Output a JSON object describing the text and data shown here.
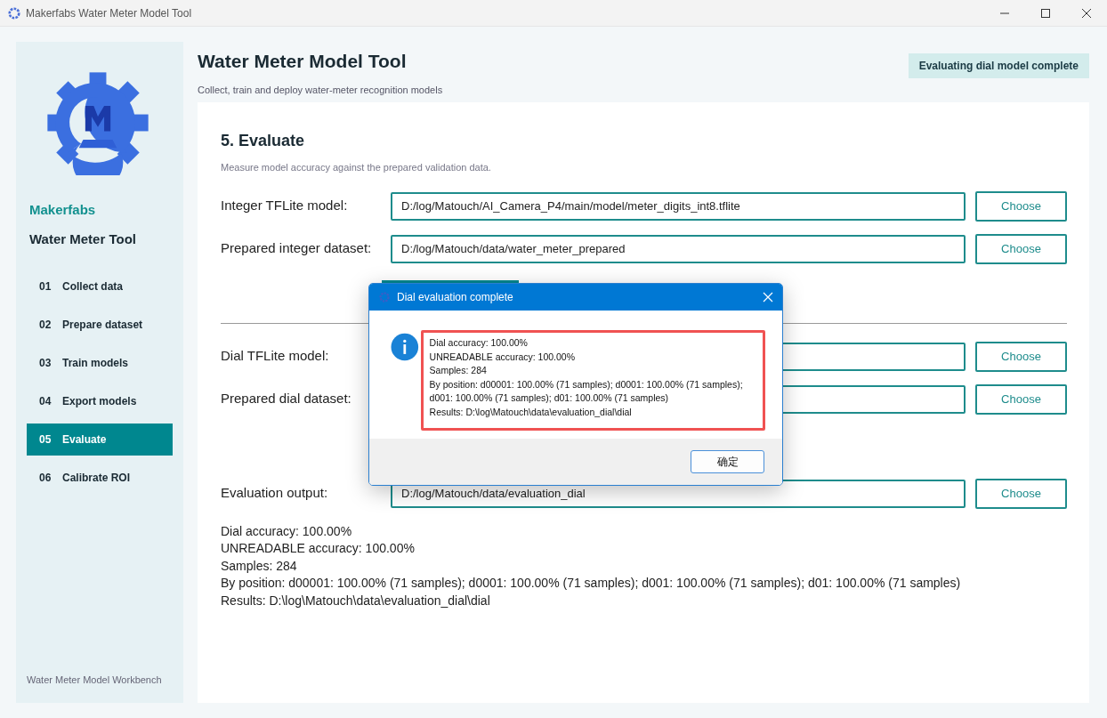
{
  "window": {
    "title": "Makerfabs Water Meter Model Tool"
  },
  "sidebar": {
    "brand": "Makerfabs",
    "product": "Water Meter Tool",
    "footer": "Water Meter Model Workbench",
    "items": [
      {
        "number": "01",
        "label": "Collect data",
        "selected": false
      },
      {
        "number": "02",
        "label": "Prepare dataset",
        "selected": false
      },
      {
        "number": "03",
        "label": "Train models",
        "selected": false
      },
      {
        "number": "04",
        "label": "Export models",
        "selected": false
      },
      {
        "number": "05",
        "label": "Evaluate",
        "selected": true
      },
      {
        "number": "06",
        "label": "Calibrate ROI",
        "selected": false
      }
    ]
  },
  "header": {
    "title": "Water Meter Model Tool",
    "subtitle": "Collect, train and deploy water-meter recognition models",
    "status": "Evaluating dial model complete"
  },
  "section": {
    "title": "5. Evaluate",
    "subtitle": "Measure model accuracy against the prepared validation data.",
    "integer_fields": [
      {
        "label": "Integer TFLite model:",
        "value": "D:/log/Matouch/AI_Camera_P4/main/model/meter_digits_int8.tflite",
        "button": "Choose"
      },
      {
        "label": "Prepared integer dataset:",
        "value": "D:/log/Matouch/data/water_meter_prepared",
        "button": "Choose"
      }
    ],
    "dial_fields": [
      {
        "label": "Dial TFLite model:",
        "button": "Choose"
      },
      {
        "label": "Prepared dial dataset:",
        "button": "Choose"
      }
    ],
    "output_field": {
      "label": "Evaluation output:",
      "value": "D:/log/Matouch/data/evaluation_dial",
      "button": "Choose"
    },
    "results": [
      "Dial accuracy: 100.00%",
      "UNREADABLE accuracy: 100.00%",
      "Samples: 284",
      "By position: d00001: 100.00% (71 samples); d0001: 100.00% (71 samples); d001: 100.00% (71 samples); d01: 100.00% (71 samples)",
      "Results: D:\\log\\Matouch\\data\\evaluation_dial\\dial"
    ]
  },
  "dialog": {
    "title": "Dial evaluation complete",
    "lines": [
      "Dial accuracy: 100.00%",
      "UNREADABLE accuracy: 100.00%",
      "Samples: 284",
      "By position: d00001: 100.00% (71 samples); d0001: 100.00% (71 samples); d001: 100.00% (71 samples); d01: 100.00% (71 samples)",
      "Results: D:\\log\\Matouch\\data\\evaluation_dial\\dial"
    ],
    "button": "确定"
  }
}
